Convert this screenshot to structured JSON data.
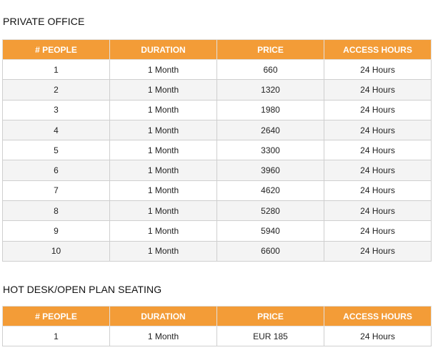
{
  "private_office": {
    "title": "PRIVATE OFFICE",
    "headers": [
      "# PEOPLE",
      "DURATION",
      "PRICE",
      "ACCESS HOURS"
    ],
    "rows": [
      [
        "1",
        "1 Month",
        "660",
        "24 Hours"
      ],
      [
        "2",
        "1 Month",
        "1320",
        "24 Hours"
      ],
      [
        "3",
        "1 Month",
        "1980",
        "24 Hours"
      ],
      [
        "4",
        "1 Month",
        "2640",
        "24 Hours"
      ],
      [
        "5",
        "1 Month",
        "3300",
        "24 Hours"
      ],
      [
        "6",
        "1 Month",
        "3960",
        "24 Hours"
      ],
      [
        "7",
        "1 Month",
        "4620",
        "24 Hours"
      ],
      [
        "8",
        "1 Month",
        "5280",
        "24 Hours"
      ],
      [
        "9",
        "1 Month",
        "5940",
        "24 Hours"
      ],
      [
        "10",
        "1 Month",
        "6600",
        "24 Hours"
      ]
    ]
  },
  "hot_desk": {
    "title": "HOT DESK/OPEN PLAN SEATING",
    "headers": [
      "# PEOPLE",
      "DURATION",
      "PRICE",
      "ACCESS HOURS"
    ],
    "rows": [
      [
        "1",
        "1 Month",
        "EUR 185",
        "24 Hours"
      ]
    ]
  },
  "colors": {
    "header_bg": "#f39c37",
    "header_text": "#ffffff",
    "stripe_bg": "#f4f4f4"
  }
}
